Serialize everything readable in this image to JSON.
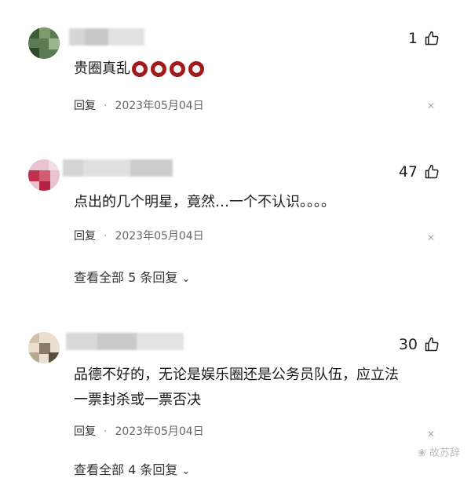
{
  "comments": [
    {
      "likes": "1",
      "text": "贵圈真乱",
      "reply_label": "回复",
      "date": "2023年05月04日",
      "reaction_icons": [
        "ring-icon",
        "ring-icon",
        "ring-icon",
        "ring-icon"
      ]
    },
    {
      "likes": "47",
      "text": "点出的几个明星，竟然…一个不认识。。。。",
      "reply_label": "回复",
      "date": "2023年05月04日",
      "see_all": "查看全部 5 条回复"
    },
    {
      "likes": "30",
      "text_line1": "品德不好的，无论是娱乐圈还是公务员队伍，应立法",
      "text_line2": "一票封杀或一票否决",
      "reply_label": "回复",
      "date": "2023年05月04日",
      "see_all": "查看全部 4 条回复"
    }
  ],
  "watermark": "故苏辞",
  "colors": {
    "ring": "#a11a1a",
    "date": "#666666",
    "close": "#aaaaaa"
  }
}
